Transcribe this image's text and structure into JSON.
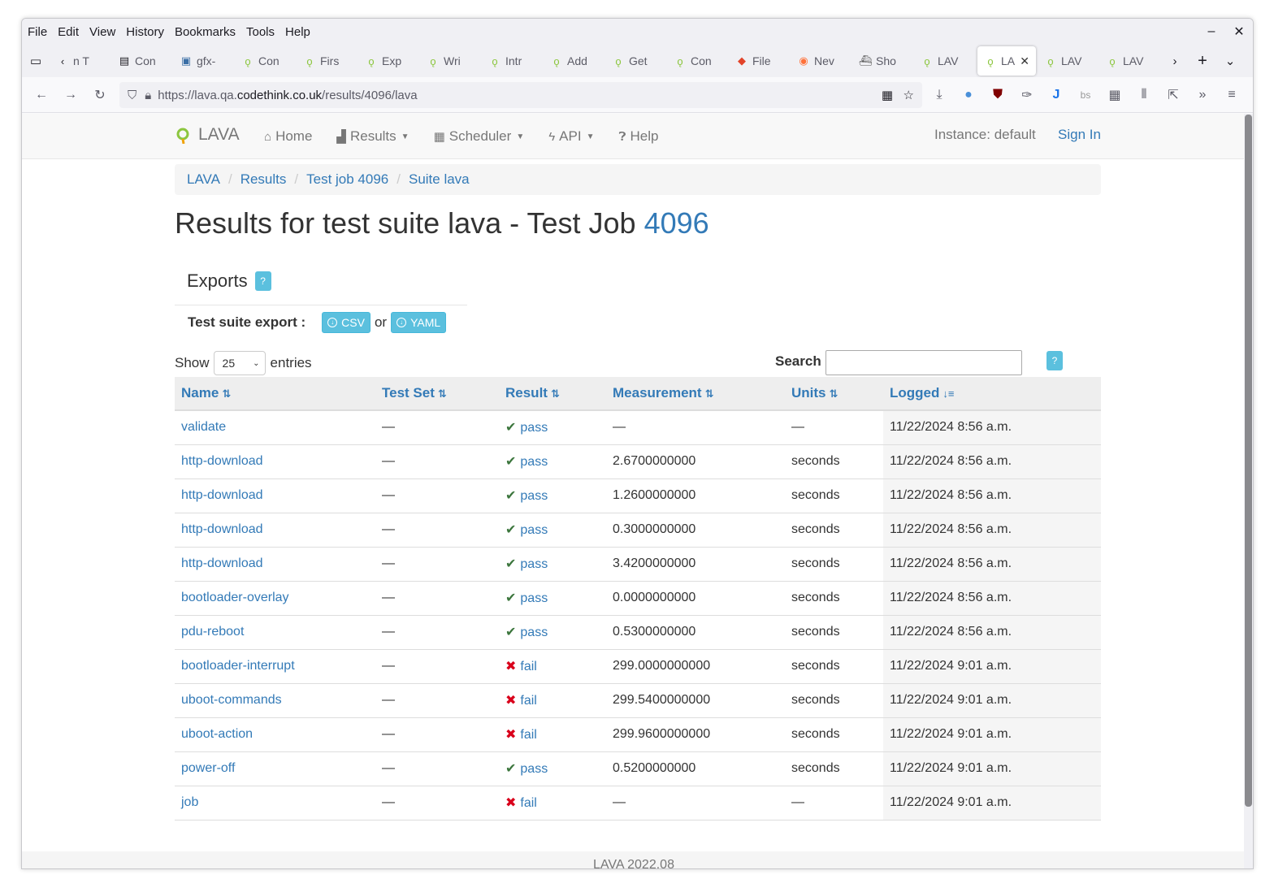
{
  "menubar": [
    "File",
    "Edit",
    "View",
    "History",
    "Bookmarks",
    "Tools",
    "Help"
  ],
  "tabs": [
    {
      "label": "n T",
      "icon": "back-icon"
    },
    {
      "label": "Con",
      "icon": "doc-icon"
    },
    {
      "label": "gfx-",
      "icon": "image-icon"
    },
    {
      "label": "Con",
      "icon": "lava-icon"
    },
    {
      "label": "Firs",
      "icon": "lava-icon"
    },
    {
      "label": "Exp",
      "icon": "lava-icon"
    },
    {
      "label": "Wri",
      "icon": "lava-icon"
    },
    {
      "label": "Intr",
      "icon": "lava-icon"
    },
    {
      "label": "Add",
      "icon": "lava-icon"
    },
    {
      "label": "Get",
      "icon": "lava-icon"
    },
    {
      "label": "Con",
      "icon": "lava-icon"
    },
    {
      "label": "File",
      "icon": "gitlab-icon"
    },
    {
      "label": "Nev",
      "icon": "firefox-icon"
    },
    {
      "label": "Sho",
      "icon": "ship-icon"
    },
    {
      "label": "LAV",
      "icon": "lava-icon"
    },
    {
      "label": "LA",
      "icon": "lava-icon",
      "active": true
    },
    {
      "label": "LAV",
      "icon": "lava-icon"
    },
    {
      "label": "LAV",
      "icon": "lava-icon"
    }
  ],
  "url": {
    "prefix": "https://lava.qa.",
    "host": "codethink.co.uk",
    "path": "/results/4096/lava"
  },
  "lava_nav": {
    "brand": "LAVA",
    "home": "Home",
    "results": "Results",
    "scheduler": "Scheduler",
    "api": "API",
    "help": "Help",
    "instance": "Instance: default",
    "sign_in": "Sign In"
  },
  "breadcrumb": [
    "LAVA",
    "Results",
    "Test job 4096",
    "Suite lava"
  ],
  "title": {
    "text": "Results for test suite lava - Test Job ",
    "job": "4096"
  },
  "exports": {
    "heading": "Exports",
    "help": "?",
    "suite_export_label": "Test suite export :",
    "csv": "CSV",
    "or": "or",
    "yaml": "YAML"
  },
  "table_controls": {
    "show": "Show",
    "entries_value": "25",
    "entries": "entries",
    "search": "Search",
    "help": "?"
  },
  "columns": [
    "Name",
    "Test Set",
    "Result",
    "Measurement",
    "Units",
    "Logged"
  ],
  "rows": [
    {
      "name": "validate",
      "test_set": "—",
      "result": "pass",
      "measurement": "—",
      "units": "—",
      "logged": "11/22/2024 8:56 a.m."
    },
    {
      "name": "http-download",
      "test_set": "—",
      "result": "pass",
      "measurement": "2.6700000000",
      "units": "seconds",
      "logged": "11/22/2024 8:56 a.m."
    },
    {
      "name": "http-download",
      "test_set": "—",
      "result": "pass",
      "measurement": "1.2600000000",
      "units": "seconds",
      "logged": "11/22/2024 8:56 a.m."
    },
    {
      "name": "http-download",
      "test_set": "—",
      "result": "pass",
      "measurement": "0.3000000000",
      "units": "seconds",
      "logged": "11/22/2024 8:56 a.m."
    },
    {
      "name": "http-download",
      "test_set": "—",
      "result": "pass",
      "measurement": "3.4200000000",
      "units": "seconds",
      "logged": "11/22/2024 8:56 a.m."
    },
    {
      "name": "bootloader-overlay",
      "test_set": "—",
      "result": "pass",
      "measurement": "0.0000000000",
      "units": "seconds",
      "logged": "11/22/2024 8:56 a.m."
    },
    {
      "name": "pdu-reboot",
      "test_set": "—",
      "result": "pass",
      "measurement": "0.5300000000",
      "units": "seconds",
      "logged": "11/22/2024 8:56 a.m."
    },
    {
      "name": "bootloader-interrupt",
      "test_set": "—",
      "result": "fail",
      "measurement": "299.0000000000",
      "units": "seconds",
      "logged": "11/22/2024 9:01 a.m."
    },
    {
      "name": "uboot-commands",
      "test_set": "—",
      "result": "fail",
      "measurement": "299.5400000000",
      "units": "seconds",
      "logged": "11/22/2024 9:01 a.m."
    },
    {
      "name": "uboot-action",
      "test_set": "—",
      "result": "fail",
      "measurement": "299.9600000000",
      "units": "seconds",
      "logged": "11/22/2024 9:01 a.m."
    },
    {
      "name": "power-off",
      "test_set": "—",
      "result": "pass",
      "measurement": "0.5200000000",
      "units": "seconds",
      "logged": "11/22/2024 9:01 a.m."
    },
    {
      "name": "job",
      "test_set": "—",
      "result": "fail",
      "measurement": "—",
      "units": "—",
      "logged": "11/22/2024 9:01 a.m."
    }
  ],
  "footer": "LAVA 2022.08",
  "colors": {
    "link": "#337ab7",
    "pass": "#3c763d",
    "fail": "#d9001b",
    "info_button": "#5bc0de"
  }
}
